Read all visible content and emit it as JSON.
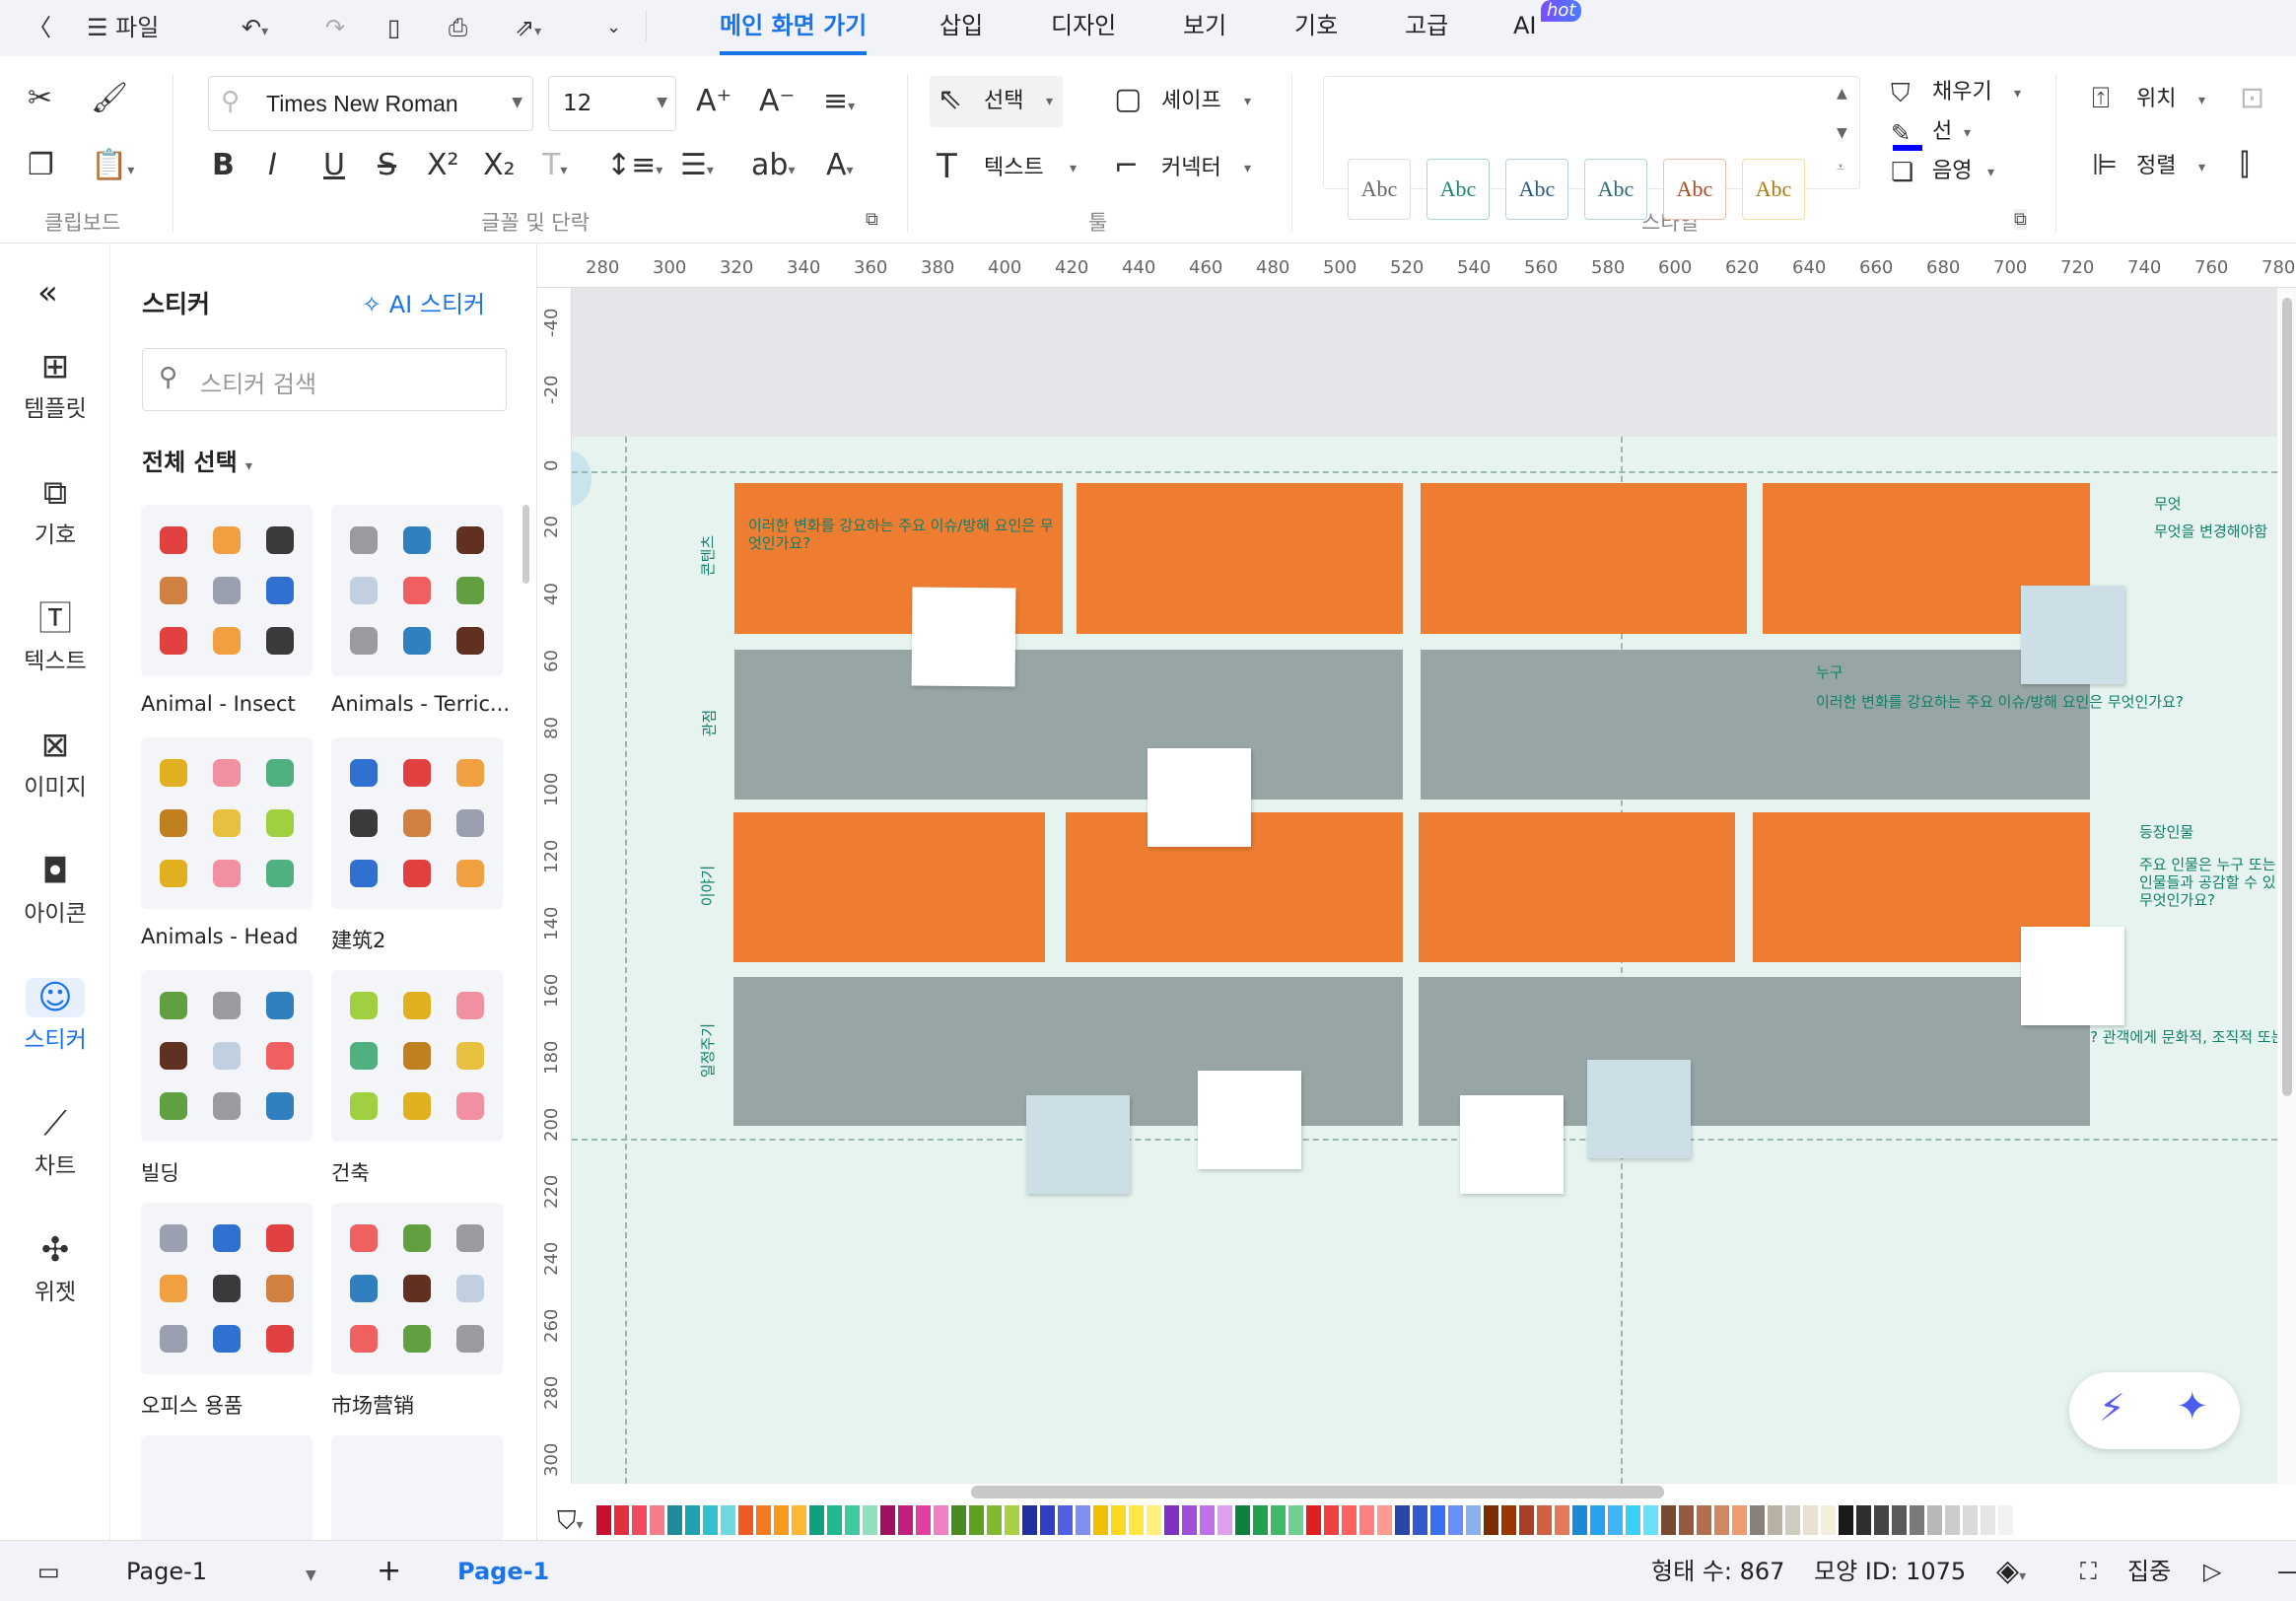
{
  "topbar": {
    "back_icon": "chevron-left-icon",
    "file_label": "파일",
    "tabs": [
      "메인 화면 가기",
      "삽입",
      "디자인",
      "보기",
      "기호",
      "고급",
      "AI"
    ],
    "active_tab": "메인 화면 가기",
    "hot_badge": "hot"
  },
  "ribbon": {
    "font_name": "Times New Roman",
    "font_size": "12",
    "groups": [
      "클립보드",
      "글꼴 및 단락",
      "툴",
      "스타일"
    ],
    "tools": {
      "select": "선택",
      "shape": "셰이프",
      "text": "텍스트",
      "connector": "커넥터"
    },
    "styles": {
      "sample": "Abc",
      "colors": [
        "#666666",
        "#1a8a6a",
        "#2a5a8a",
        "#2a6a7a",
        "#b04a20",
        "#b07a10"
      ],
      "borders": [
        "#dddddd",
        "#a8dcc8",
        "#b8d0ee",
        "#b8d8e0",
        "#f4c0aa",
        "#f8dca0"
      ]
    },
    "fill": "채우기",
    "line": "선",
    "shadow": "음영",
    "position": "위치",
    "align": "정렬",
    "line_color": "#0000ff"
  },
  "rail": {
    "collapse_icon": "double-chevron-left-icon",
    "items": [
      {
        "label": "템플릿",
        "icon": "template-icon"
      },
      {
        "label": "기호",
        "icon": "symbol-icon"
      },
      {
        "label": "텍스트",
        "icon": "text-icon"
      },
      {
        "label": "이미지",
        "icon": "image-icon"
      },
      {
        "label": "아이콘",
        "icon": "icon-icon"
      },
      {
        "label": "스티커",
        "icon": "sticker-icon",
        "active": true
      },
      {
        "label": "차트",
        "icon": "chart-icon"
      },
      {
        "label": "위젯",
        "icon": "widget-icon"
      }
    ]
  },
  "panel": {
    "title": "스티커",
    "ai_button": "AI 스티커",
    "search_placeholder": "스티커 검색",
    "select_all": "전체 선택",
    "categories": [
      "Animal - Insect",
      "Animals - Terric...",
      "Animals - Head",
      "建筑2",
      "빌딩",
      "건축",
      "오피스 용품",
      "市场营销"
    ]
  },
  "ruler": {
    "x": [
      "280",
      "300",
      "320",
      "340",
      "360",
      "380",
      "400",
      "420",
      "440",
      "460",
      "480",
      "500",
      "520",
      "540",
      "560",
      "580",
      "600",
      "620",
      "640",
      "660",
      "680",
      "700",
      "720",
      "740",
      "760",
      "780"
    ],
    "y": [
      "-40",
      "-20",
      "0",
      "20",
      "40",
      "60",
      "80",
      "100",
      "120",
      "140",
      "160",
      "180",
      "200",
      "220",
      "240",
      "260",
      "280",
      "300"
    ]
  },
  "canvas": {
    "row_labels": [
      "콘텐츠",
      "관점",
      "이야기",
      "일정주기"
    ],
    "box_question": "이러한 변화를 강요하는 주요 이슈/방해 요인은 무엇인가요?",
    "what_title": "무엇",
    "what_text": "무엇을 변경해야함",
    "who_title": "누구",
    "who_question": "이러한 변화를 강요하는 주요 이슈/방해 요인은 무엇인가요?",
    "characters_title": "등장인물",
    "characters_text": "주요 인물은 누구 또는\n인물들과 공감할 수 있\n무엇인가요?",
    "audience_text": "? 관객에게 문화적, 조직적 또는",
    "colors": {
      "orange": "#ee7d31",
      "gray": "#97a6a5",
      "page": "#e6f3ef",
      "text": "#0f7f6a",
      "note_blue": "#cddfe6"
    }
  },
  "palette": [
    "#c8102e",
    "#e03040",
    "#f04a60",
    "#f77b8a",
    "#1e8a9a",
    "#20a0b0",
    "#30c0d0",
    "#70d8e0",
    "#f05a20",
    "#f47a20",
    "#f89a20",
    "#fbb830",
    "#10a080",
    "#20b890",
    "#40c8a0",
    "#90e0c0",
    "#a01060",
    "#c02080",
    "#e040a0",
    "#f080c0",
    "#4a8a20",
    "#60a020",
    "#80b830",
    "#a8d040",
    "#2030a0",
    "#3040c0",
    "#5060e0",
    "#8090f0",
    "#f0c000",
    "#f8d820",
    "#fce840",
    "#fff080",
    "#8030c0",
    "#a050d8",
    "#c070e8",
    "#e0a0f0",
    "#108040",
    "#20a050",
    "#40b868",
    "#70d090",
    "#e02020",
    "#f04040",
    "#ff6060",
    "#ff8080",
    "#ff9a90",
    "#2a44a8",
    "#3358cc",
    "#3a6ff0",
    "#6a8ef8",
    "#8ab0f0",
    "#7a2e00",
    "#983800",
    "#a84028",
    "#d06040",
    "#e47a5a",
    "#1a8ad8",
    "#2aa0f0",
    "#40b4f8",
    "#3ccff8",
    "#68e0f8",
    "#7a4a30",
    "#945a40",
    "#b07050",
    "#d08860",
    "#f09a70",
    "#8a8078",
    "#b8b0a0",
    "#d0ccc0",
    "#e8e0d0",
    "#f4eedc",
    "#1a1a1a",
    "#2e2e2e",
    "#444444",
    "#5a5a5a",
    "#7a7a7a",
    "#b8b8b8",
    "#cccccc",
    "#dadada",
    "#e6e6e6",
    "#f2f2f2"
  ],
  "status": {
    "page_select": "Page-1",
    "page_tab": "Page-1",
    "shape_count": "형태 수: 867",
    "shape_id": "모양 ID: 1075",
    "focus": "집중"
  }
}
